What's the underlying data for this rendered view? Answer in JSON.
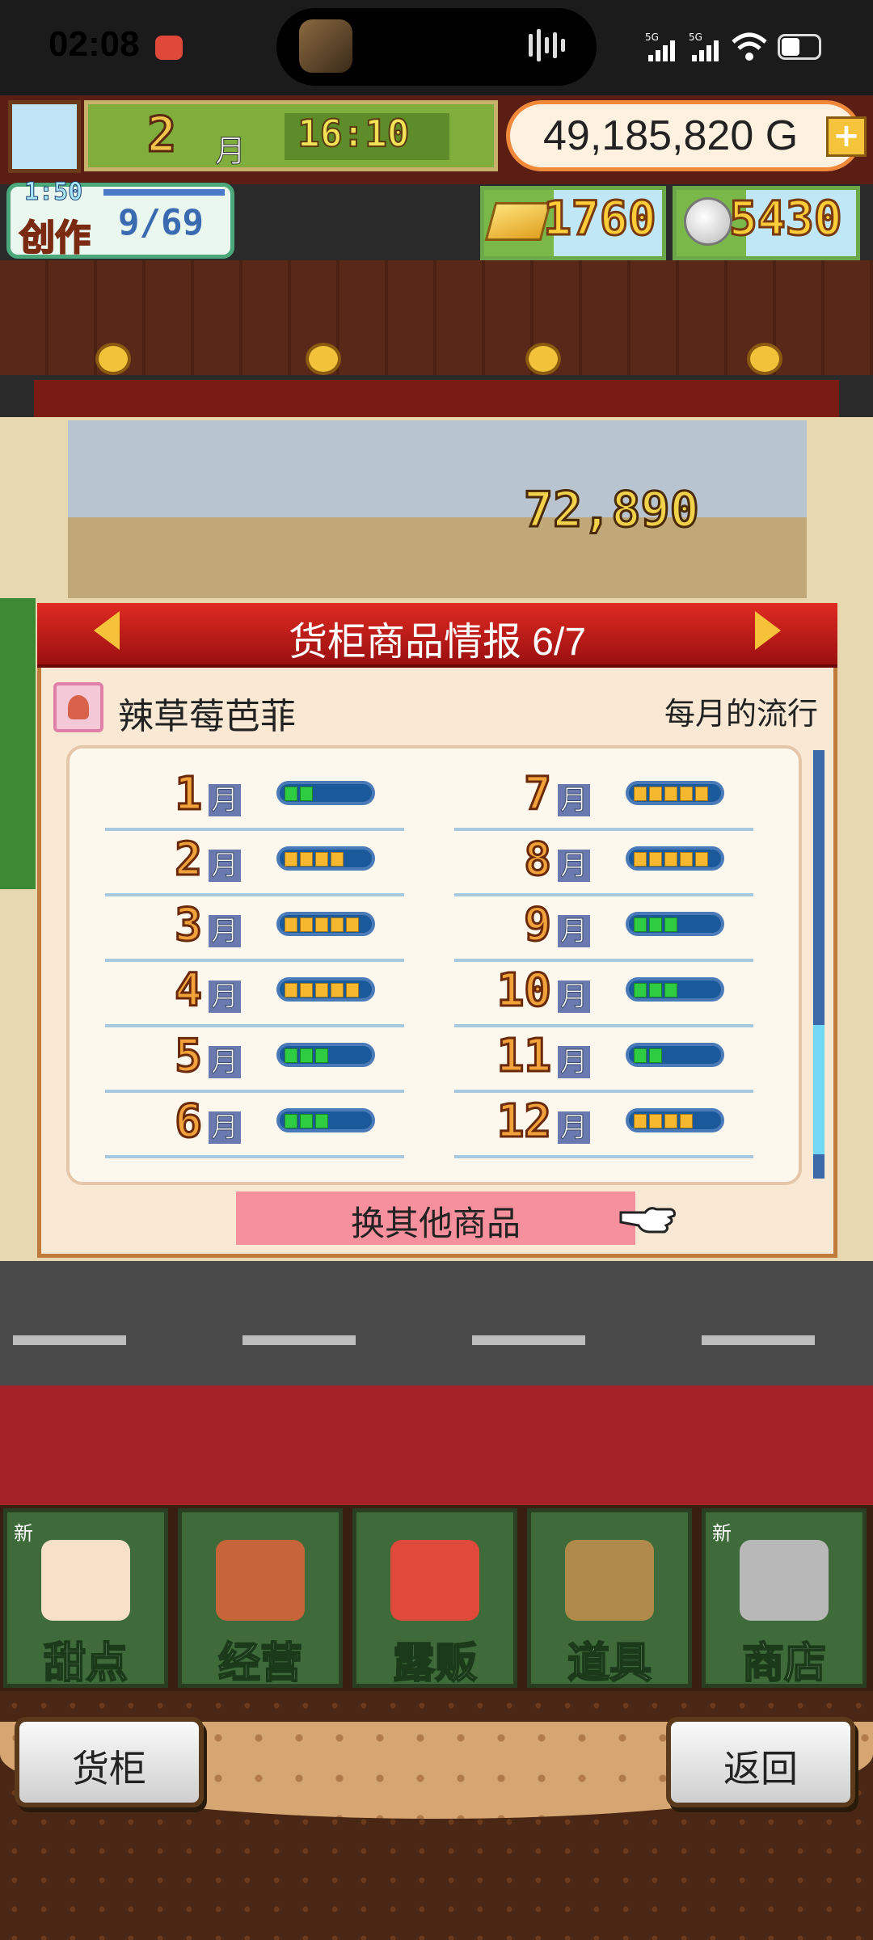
{
  "status_bar": {
    "time": "02:08",
    "icons": [
      "record-icon",
      "app-icon",
      "audio-wave-icon",
      "signal-5g-icon",
      "signal-5g-icon",
      "wifi-icon",
      "battery-icon"
    ]
  },
  "hud": {
    "month_number": "2",
    "month_unit": "月",
    "game_time": "16:10",
    "money": "49,185,820 G",
    "create_timer": "1:50",
    "create_label": "创作",
    "create_count": "9/69",
    "gold": "1760",
    "coins": "5430"
  },
  "scene": {
    "floating_score": "72,890"
  },
  "dialog": {
    "title": "货柜商品情报 6/7",
    "item_name": "辣草莓芭菲",
    "trend_label": "每月的流行",
    "month_unit": "月",
    "switch_button": "换其他商品",
    "months": [
      {
        "month": "1",
        "level": 2,
        "max": 5
      },
      {
        "month": "2",
        "level": 4,
        "max": 5
      },
      {
        "month": "3",
        "level": 5,
        "max": 5
      },
      {
        "month": "4",
        "level": 5,
        "max": 5
      },
      {
        "month": "5",
        "level": 3,
        "max": 5
      },
      {
        "month": "6",
        "level": 3,
        "max": 5
      },
      {
        "month": "7",
        "level": 5,
        "max": 5
      },
      {
        "month": "8",
        "level": 5,
        "max": 5
      },
      {
        "month": "9",
        "level": 3,
        "max": 5
      },
      {
        "month": "10",
        "level": 3,
        "max": 5
      },
      {
        "month": "11",
        "level": 2,
        "max": 5
      },
      {
        "month": "12",
        "level": 4,
        "max": 5
      }
    ],
    "bar_colors": {
      "low": "#2ecc40",
      "high": "#f5b82e"
    }
  },
  "menu": {
    "new_badge": "新",
    "items": [
      {
        "label": "甜点",
        "new": true
      },
      {
        "label": "经营",
        "new": false
      },
      {
        "label": "露贩",
        "new": false
      },
      {
        "label": "道具",
        "new": false
      },
      {
        "label": "商店",
        "new": true
      }
    ]
  },
  "footer": {
    "left_button": "货柜",
    "right_button": "返回"
  }
}
